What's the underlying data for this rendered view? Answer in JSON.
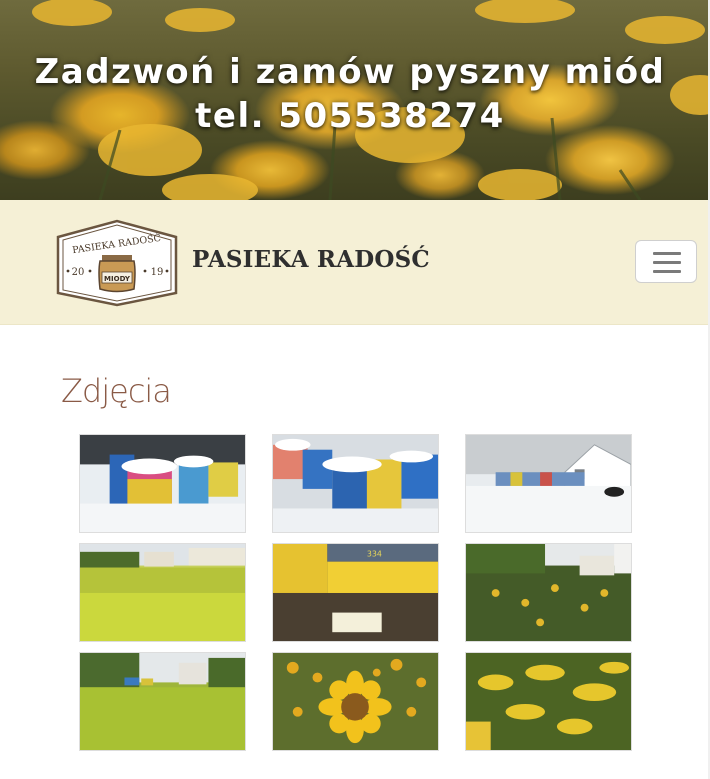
{
  "hero": {
    "line1": "Zadzwoń i zamów pyszny miód",
    "line2": "tel. 505538274"
  },
  "navbar": {
    "brand": "PASIEKA RADOŚĆ",
    "logo": {
      "top_text": "PASIEKA RADOŚĆ",
      "year_left": "20",
      "year_right": "19",
      "jar_label": "MIODY"
    },
    "toggler_icon": "hamburger-menu-icon"
  },
  "main": {
    "heading": "Zdjęcia"
  },
  "gallery": {
    "photos": [
      {
        "id": "winter-hives-1"
      },
      {
        "id": "winter-hives-2"
      },
      {
        "id": "winter-apiary-house"
      },
      {
        "id": "rapeseed-field-village"
      },
      {
        "id": "yellow-hive-boxes"
      },
      {
        "id": "sunflower-field-hives"
      },
      {
        "id": "meadow-hives"
      },
      {
        "id": "sunflower-closeup"
      },
      {
        "id": "goldenrod-hive"
      }
    ]
  },
  "colors": {
    "navbar_bg": "#f5f0d6",
    "heading": "#8a5a46",
    "brand_text": "#2f2f2f"
  }
}
